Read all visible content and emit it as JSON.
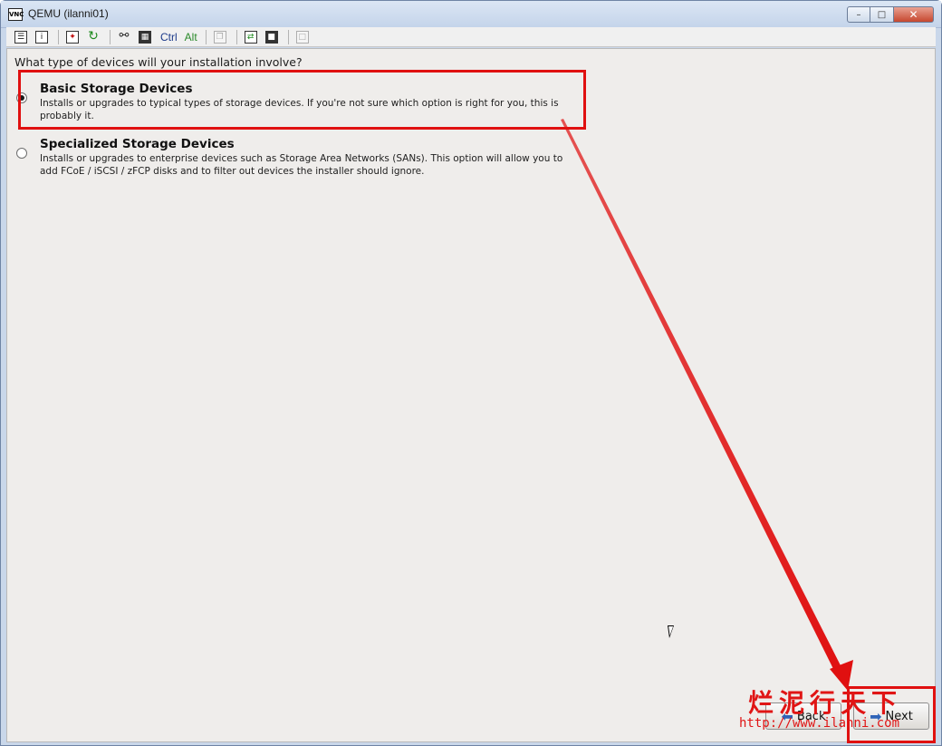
{
  "window": {
    "title": "QEMU (ilanni01)",
    "icon_label": "VNC"
  },
  "toolbar": {
    "ctrl_label": "Ctrl",
    "alt_label": "Alt",
    "icons": [
      "options-icon",
      "info-icon",
      "fullscreen-icon",
      "refresh-icon",
      "keys-icon",
      "ctrl-alt-del-icon",
      "copy-icon",
      "transfer-icon",
      "save-icon",
      "stop-icon"
    ]
  },
  "installer": {
    "question": "What type of devices will your installation involve?",
    "options": [
      {
        "title": "Basic Storage Devices",
        "description": "Installs or upgrades to typical types of storage devices.  If you're not sure which option is right for you, this is probably it.",
        "selected": true
      },
      {
        "title": "Specialized Storage Devices",
        "description": "Installs or upgrades to enterprise devices such as Storage Area Networks (SANs). This option will allow you to add FCoE / iSCSI / zFCP disks and to filter out devices the installer should ignore.",
        "selected": false
      }
    ],
    "back_label": "Back",
    "next_label": "Next"
  },
  "watermark": {
    "chinese": "烂泥行天下",
    "url": "http://www.ilanni.com"
  },
  "colors": {
    "highlight": "#e01010",
    "screen_bg": "#efedeb",
    "accent_arrow": "#2e63b8"
  }
}
